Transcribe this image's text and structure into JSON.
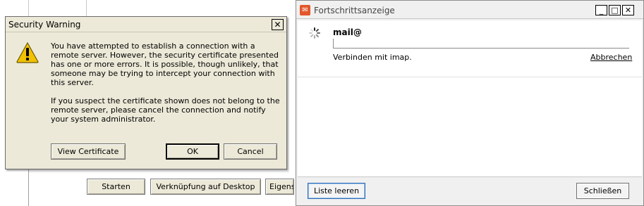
{
  "background_window": {
    "buttons": [
      "Starten",
      "Verknüpfung auf Desktop",
      "Eigens"
    ]
  },
  "security_dialog": {
    "title": "Security Warning",
    "close_glyph": "✕",
    "icon": "warning-icon",
    "message_paragraphs": [
      "You have attempted to establish a connection with a remote server. However, the security certificate presented has one or more errors. It is possible, though unlikely, that someone may be trying to intercept your connection with this server.",
      "If you suspect the certificate shown does not belong to the remote server, please cancel the connection and notify your system administrator."
    ],
    "buttons": {
      "view_certificate": "View Certificate",
      "ok": "OK",
      "cancel": "Cancel"
    }
  },
  "progress_window": {
    "title": "Fortschrittsanzeige",
    "app_icon_glyph": "✉",
    "window_controls": {
      "minimize": "_",
      "maximize": "□",
      "close": "✕"
    },
    "task": {
      "name": "mail@",
      "status": "Verbinden mit imap.",
      "cancel_link": "Abbrechen",
      "progress": 0
    },
    "footer": {
      "clear_list": "Liste leeren",
      "close": "Schließen"
    }
  },
  "colors": {
    "dialog_bg": "#ece9d8",
    "progress_bg": "#f0f0f0",
    "app_icon": "#e2572b",
    "warning_yellow": "#f2c200"
  }
}
